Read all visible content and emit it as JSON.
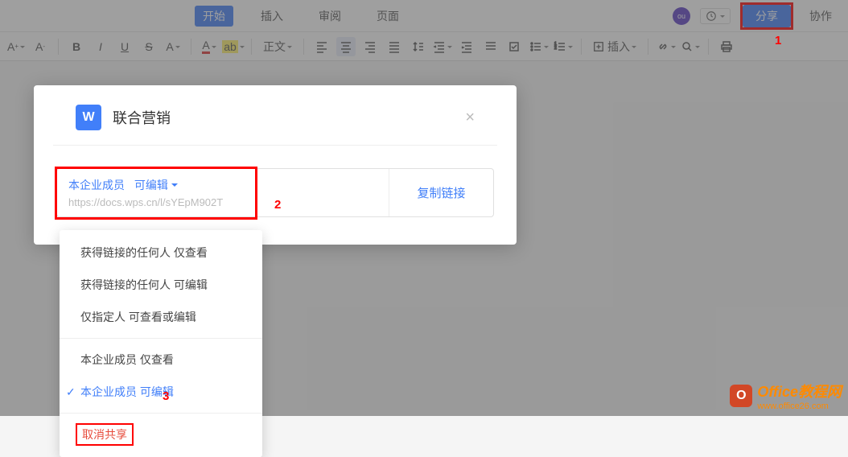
{
  "topbar": {
    "tabs": [
      "开始",
      "插入",
      "审阅",
      "页面"
    ],
    "avatar": "ou",
    "share": "分享",
    "collab": "协作"
  },
  "toolbar": {
    "body_text": "正文",
    "insert": "插入"
  },
  "dialog": {
    "title": "联合营销",
    "perm_prefix": "本企业成员",
    "perm_mode": "可编辑",
    "url": "https://docs.wps.cn/l/sYEpM902T",
    "copy": "复制链接"
  },
  "dropdown": {
    "items": [
      "获得链接的任何人 仅查看",
      "获得链接的任何人 可编辑",
      "仅指定人 可查看或编辑",
      "本企业成员 仅查看",
      "本企业成员 可编辑"
    ],
    "cancel": "取消共享"
  },
  "annotations": {
    "a1": "1",
    "a2": "2",
    "a3": "3"
  },
  "watermark": {
    "brand": "Office",
    "suffix": "教程网",
    "url": "www.office26.com"
  }
}
